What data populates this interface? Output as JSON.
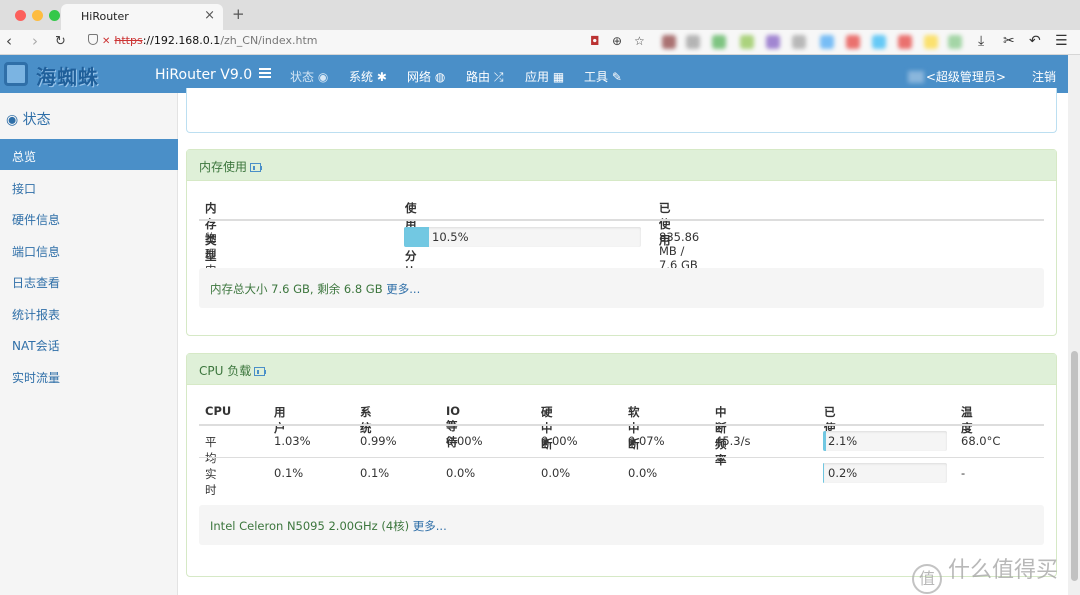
{
  "browser": {
    "tab_title": "HiRouter",
    "tab_close": "×",
    "new_tab": "+",
    "url_scheme": "https",
    "url_host": "://192.168.0.1",
    "url_path": "/zh_CN/index.htm",
    "icons": [
      "back-icon",
      "forward-icon",
      "reload-icon",
      "shield-icon",
      "zoom-icon",
      "star-icon",
      "download-icon",
      "cut-icon",
      "undo-icon",
      "menu-icon"
    ]
  },
  "header": {
    "logo_text": "海蜘蛛",
    "brand": "HiRouter V9.0",
    "nav": [
      {
        "label": "状态",
        "icon": "eye-icon",
        "glyph": "◉"
      },
      {
        "label": "系统",
        "icon": "gear-icon",
        "glyph": "✱"
      },
      {
        "label": "网络",
        "icon": "globe-icon",
        "glyph": "◍"
      },
      {
        "label": "路由",
        "icon": "shuffle-icon",
        "glyph": "⤮"
      },
      {
        "label": "应用",
        "icon": "grid-icon",
        "glyph": "▦"
      },
      {
        "label": "工具",
        "icon": "wrench-icon",
        "glyph": "✎"
      }
    ],
    "user": "<超级管理员>",
    "logout": "注销"
  },
  "sidebar": {
    "title": "状态",
    "items": [
      {
        "label": "总览",
        "active": true
      },
      {
        "label": "接口"
      },
      {
        "label": "硬件信息"
      },
      {
        "label": "端口信息"
      },
      {
        "label": "日志查看"
      },
      {
        "label": "统计报表"
      },
      {
        "label": "NAT会话"
      },
      {
        "label": "实时流量"
      }
    ]
  },
  "memory": {
    "title": "内存使用",
    "columns": [
      "内存类型",
      "使用百分比",
      "已使用"
    ],
    "row": {
      "type": "物理内存",
      "percent_label": "10.5%",
      "percent": 10.5,
      "used": "835.86 MB / 7.6 GB"
    },
    "summary": "内存总大小 7.6 GB, 剩余 6.8 GB",
    "more": "更多..."
  },
  "cpu": {
    "title": "CPU 负载",
    "columns": [
      "CPU",
      "用户",
      "系统",
      "IO 等待",
      "硬中断",
      "软中断",
      "中断频率",
      "已使用",
      "温度"
    ],
    "rows": [
      {
        "name": "平均",
        "user": "1.03%",
        "system": "0.99%",
        "io": "0.00%",
        "hardirq": "0.00%",
        "softirq": "0.07%",
        "irq_rate": "45.3/s",
        "used_label": "2.1%",
        "used": 2.1,
        "temp": "68.0°C"
      },
      {
        "name": "实时",
        "user": "0.1%",
        "system": "0.1%",
        "io": "0.0%",
        "hardirq": "0.0%",
        "softirq": "0.0%",
        "irq_rate": "",
        "used_label": "0.2%",
        "used": 0.2,
        "temp": "-"
      }
    ],
    "summary": "Intel Celeron N5095 2.00GHz (4核)",
    "more": "更多..."
  },
  "watermark": "什么值得买",
  "watermark_mark": "值",
  "colors": {
    "accent": "#4a8fc8",
    "panel_head": "#dff0d8",
    "bar_fill": "#5bc0de"
  }
}
